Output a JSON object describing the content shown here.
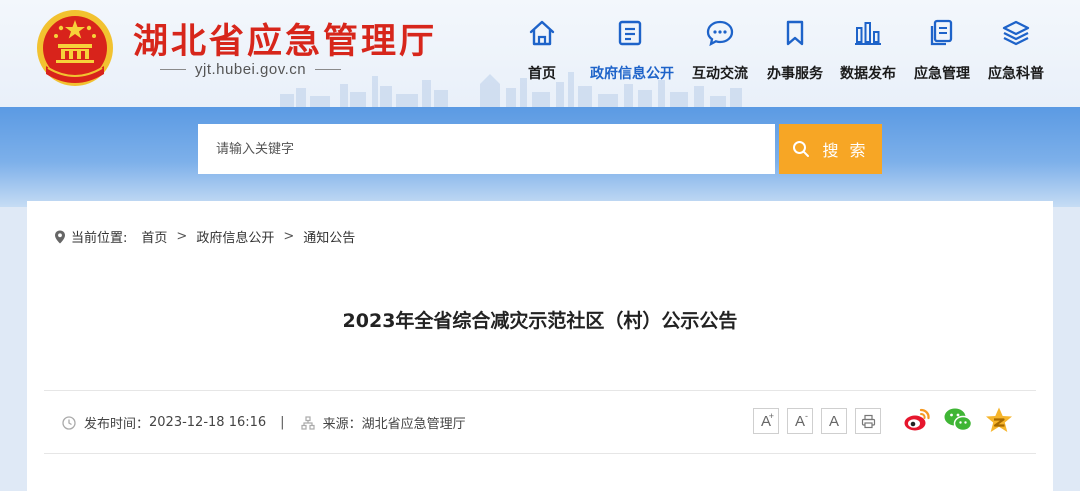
{
  "site": {
    "title": "湖北省应急管理厅",
    "domain": "yjt.hubei.gov.cn"
  },
  "nav": [
    {
      "label": "首页",
      "icon": "home-icon"
    },
    {
      "label": "政府信息公开",
      "icon": "document-icon",
      "active": true
    },
    {
      "label": "互动交流",
      "icon": "chat-icon"
    },
    {
      "label": "办事服务",
      "icon": "bookmark-icon"
    },
    {
      "label": "数据发布",
      "icon": "bar-chart-icon"
    },
    {
      "label": "应急管理",
      "icon": "files-icon"
    },
    {
      "label": "应急科普",
      "icon": "layers-icon"
    }
  ],
  "search": {
    "placeholder": "请输入关键字",
    "button_label": "搜 索"
  },
  "breadcrumb": {
    "prefix": "当前位置:",
    "items": [
      "首页",
      "政府信息公开",
      "通知公告"
    ],
    "separator": ">"
  },
  "article": {
    "title": "2023年全省综合减灾示范社区（村）公示公告",
    "publish_label": "发布时间：",
    "publish_time": "2023-12-18 16:16",
    "divider": "|",
    "source_label": "来源：",
    "source": "湖北省应急管理厅"
  },
  "tools": {
    "font_large": "A",
    "font_medium": "A",
    "font_small": "A",
    "print_icon": "print-icon"
  },
  "share": [
    "weibo-icon",
    "wechat-icon",
    "qzone-icon"
  ],
  "colors": {
    "brand_red": "#d7261b",
    "nav_blue": "#1e63c9",
    "search_orange": "#f7a625",
    "band_blue": "#5b9ae3"
  }
}
